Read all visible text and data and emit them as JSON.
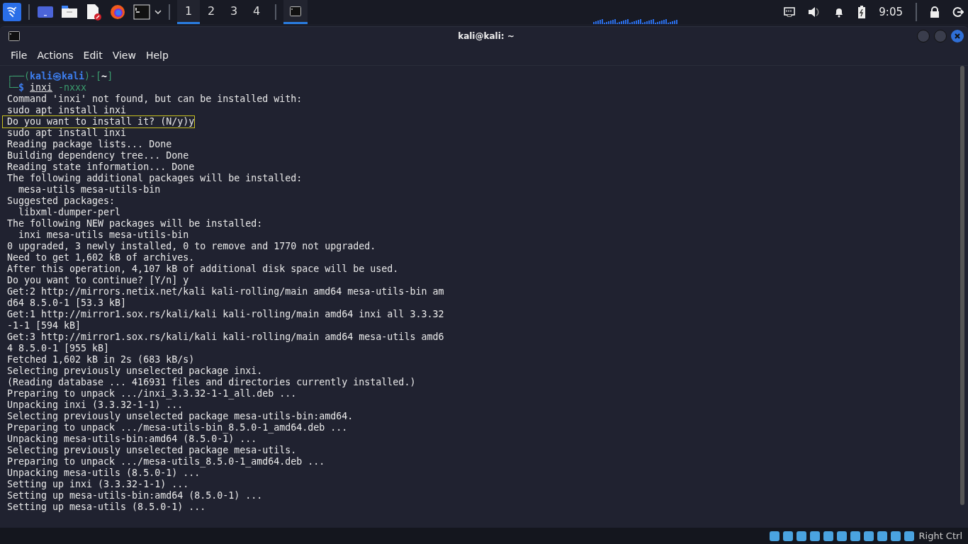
{
  "taskbar": {
    "workspaces": [
      {
        "label": "1",
        "selected": true
      },
      {
        "label": "2",
        "selected": false
      },
      {
        "label": "3",
        "selected": false
      },
      {
        "label": "4",
        "selected": false
      }
    ],
    "task_buttons": [
      {
        "selected": true
      }
    ],
    "clock": "9:05"
  },
  "window": {
    "title": "kali@kali: ~",
    "menu": [
      "File",
      "Actions",
      "Edit",
      "View",
      "Help"
    ]
  },
  "terminal": {
    "prompt": {
      "open": "┌──(",
      "user": "kali",
      "at": "㉿",
      "host": "kali",
      "mid": ")-[",
      "cwd": "~",
      "close": "]",
      "corner": "└─",
      "symbol": "$",
      "command": "inxi",
      "args": "-nxxx"
    },
    "lines": [
      {
        "text": "Command 'inxi' not found, but can be installed with:",
        "highlighted": false
      },
      {
        "text": "sudo apt install inxi",
        "highlighted": false
      },
      {
        "text": "Do you want to install it? (N/y)y",
        "highlighted": true
      },
      {
        "text": "sudo apt install inxi",
        "highlighted": false
      },
      {
        "text": "Reading package lists... Done",
        "highlighted": false
      },
      {
        "text": "Building dependency tree... Done",
        "highlighted": false
      },
      {
        "text": "Reading state information... Done",
        "highlighted": false
      },
      {
        "text": "The following additional packages will be installed:",
        "highlighted": false
      },
      {
        "text": "  mesa-utils mesa-utils-bin",
        "highlighted": false
      },
      {
        "text": "Suggested packages:",
        "highlighted": false
      },
      {
        "text": "  libxml-dumper-perl",
        "highlighted": false
      },
      {
        "text": "The following NEW packages will be installed:",
        "highlighted": false
      },
      {
        "text": "  inxi mesa-utils mesa-utils-bin",
        "highlighted": false
      },
      {
        "text": "0 upgraded, 3 newly installed, 0 to remove and 1770 not upgraded.",
        "highlighted": false
      },
      {
        "text": "Need to get 1,602 kB of archives.",
        "highlighted": false
      },
      {
        "text": "After this operation, 4,107 kB of additional disk space will be used.",
        "highlighted": false
      },
      {
        "text": "Do you want to continue? [Y/n] y",
        "highlighted": false
      },
      {
        "text": "Get:2 http://mirrors.netix.net/kali kali-rolling/main amd64 mesa-utils-bin am",
        "highlighted": false
      },
      {
        "text": "d64 8.5.0-1 [53.3 kB]",
        "highlighted": false
      },
      {
        "text": "Get:1 http://mirror1.sox.rs/kali/kali kali-rolling/main amd64 inxi all 3.3.32",
        "highlighted": false
      },
      {
        "text": "-1-1 [594 kB]",
        "highlighted": false
      },
      {
        "text": "Get:3 http://mirror1.sox.rs/kali/kali kali-rolling/main amd64 mesa-utils amd6",
        "highlighted": false
      },
      {
        "text": "4 8.5.0-1 [955 kB]",
        "highlighted": false
      },
      {
        "text": "Fetched 1,602 kB in 2s (683 kB/s)",
        "highlighted": false
      },
      {
        "text": "Selecting previously unselected package inxi.",
        "highlighted": false
      },
      {
        "text": "(Reading database ... 416931 files and directories currently installed.)",
        "highlighted": false
      },
      {
        "text": "Preparing to unpack .../inxi_3.3.32-1-1_all.deb ...",
        "highlighted": false
      },
      {
        "text": "Unpacking inxi (3.3.32-1-1) ...",
        "highlighted": false
      },
      {
        "text": "Selecting previously unselected package mesa-utils-bin:amd64.",
        "highlighted": false
      },
      {
        "text": "Preparing to unpack .../mesa-utils-bin_8.5.0-1_amd64.deb ...",
        "highlighted": false
      },
      {
        "text": "Unpacking mesa-utils-bin:amd64 (8.5.0-1) ...",
        "highlighted": false
      },
      {
        "text": "Selecting previously unselected package mesa-utils.",
        "highlighted": false
      },
      {
        "text": "Preparing to unpack .../mesa-utils_8.5.0-1_amd64.deb ...",
        "highlighted": false
      },
      {
        "text": "Unpacking mesa-utils (8.5.0-1) ...",
        "highlighted": false
      },
      {
        "text": "Setting up inxi (3.3.32-1-1) ...",
        "highlighted": false
      },
      {
        "text": "Setting up mesa-utils-bin:amd64 (8.5.0-1) ...",
        "highlighted": false
      },
      {
        "text": "Setting up mesa-utils (8.5.0-1) ...",
        "highlighted": false
      }
    ]
  },
  "host_status_bar": {
    "host_key": "Right Ctrl"
  }
}
